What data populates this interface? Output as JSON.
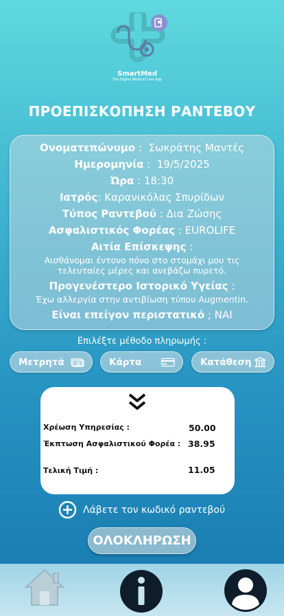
{
  "brand": {
    "name": "SmartMed",
    "tagline": "The Digital Medical Care App"
  },
  "page_title": "ΠΡΟΕΠΙΣΚΟΠΗΣΗ ΡΑΝΤΕΒΟΥ",
  "summary": {
    "fullname_label": "Ονοματεπώνυμο",
    "fullname_value": "Σωκράτης Μαντές",
    "date_label": "Ημερομηνία",
    "date_value": "19/5/2025",
    "time_label": "Ώρα",
    "time_value": "18:30",
    "doctor_label": "Ιατρός",
    "doctor_value": "Καρανικόλας Σπυρίδων",
    "type_label": "Τύπος Ραντεβού",
    "type_value": "Δια Ζώσης",
    "insurer_label": "Ασφαλιστικός Φορέας",
    "insurer_value": "EUROLIFE",
    "reason_label": "Αιτία Επίσκεψης",
    "reason_line1": "Αισθάνομαι έντονο πόνο στο στομάχι μου τις",
    "reason_line2": "τελευταίες μέρες και ανεβάζω πυρετό.",
    "history_label": "Προγενέστερο Ιστορικό Υγείας",
    "history_value": "Έχω αλλεργία στην αντιβίωση τύπου Augmentin.",
    "urgent_label": "Είναι επείγον περιστατικό",
    "urgent_value": "ΝΑΙ"
  },
  "payment": {
    "prompt": "Επιλέξτε μέθοδο πληρωμής :",
    "cash": "Μετρητά",
    "card": "Κάρτα",
    "deposit": "Κατάθεση"
  },
  "pricing": {
    "service_label": "Χρέωση Υπηρεσίας :",
    "service_value": "50.00",
    "discount_label": "Έκπτωση Ασφαλιστικού Φορέα :",
    "discount_value": "38.95",
    "total_label": "Τελική Τιμή :",
    "total_value": "11.05"
  },
  "get_code": "Λάβετε τον κωδικό ραντεβού",
  "complete_button": "ΟΛΟΚΛΗΡΩΣΗ",
  "nav": {
    "icons": [
      "home-icon",
      "info-icon",
      "user-icon"
    ]
  },
  "colors": {
    "gradient_top": "#5fd9df",
    "gradient_bottom": "#1778ad",
    "nav_bar": "#c7e6f1",
    "dark_icon": "#0f1d2b"
  }
}
